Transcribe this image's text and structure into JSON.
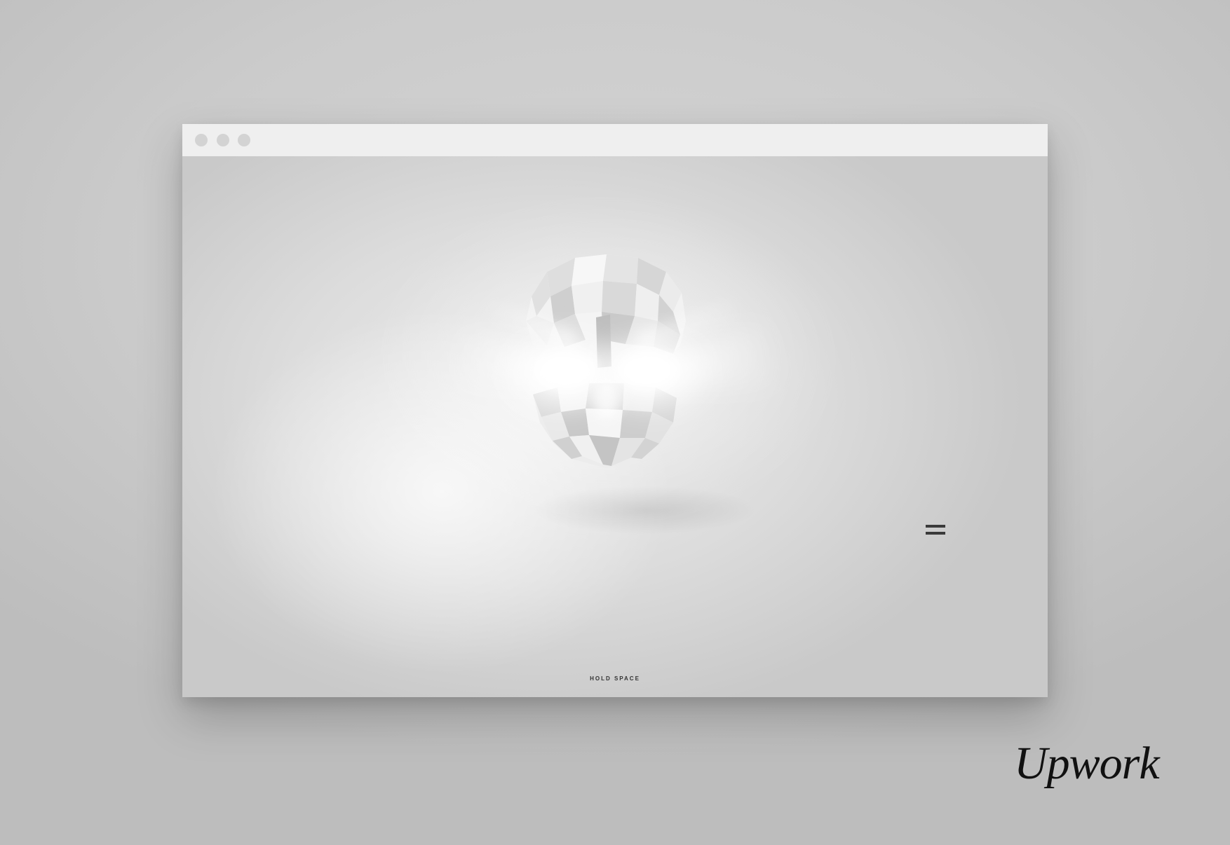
{
  "window": {
    "controls": [
      "close-dot",
      "minimize-dot",
      "maximize-dot"
    ],
    "chrome_color": "#efefef",
    "dot_color": "#d3d3d3"
  },
  "page": {
    "background_color": "#dcdcdc",
    "hero_graphic": "glowing-low-poly-skull",
    "menu_icon": "hamburger-menu-icon",
    "hint_text": "HOLD SPACE"
  },
  "brand": {
    "logo_text": "Upwork"
  }
}
